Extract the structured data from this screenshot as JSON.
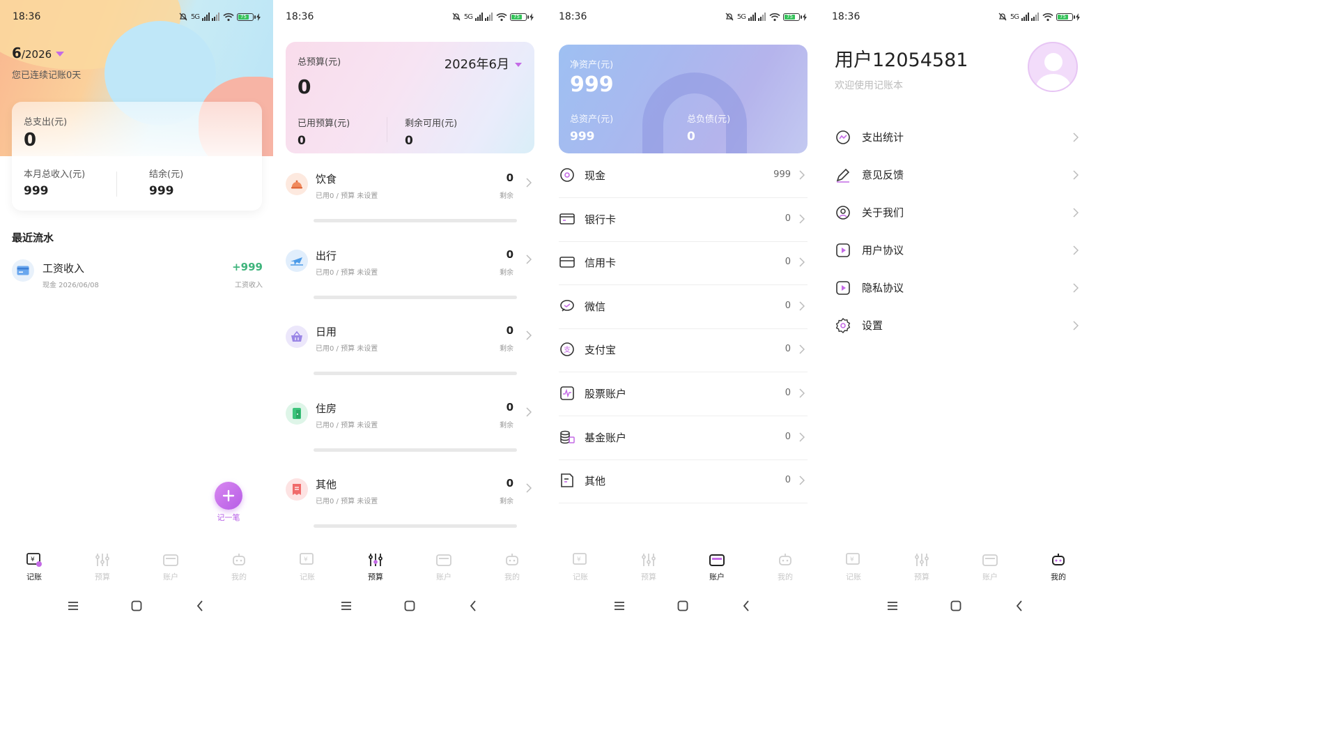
{
  "status": {
    "time": "18:36",
    "battery": "75",
    "signal": "5G"
  },
  "tabs": [
    {
      "label": "记账",
      "icon": "ledger-icon"
    },
    {
      "label": "预算",
      "icon": "sliders-icon"
    },
    {
      "label": "账户",
      "icon": "wallet-icon"
    },
    {
      "label": "我的",
      "icon": "robot-icon"
    }
  ],
  "colors": {
    "accent": "#c46ae6",
    "income": "#3fb47c"
  },
  "ledger": {
    "month_main": "6",
    "month_year": "/2026",
    "streak": "您已连续记账0天",
    "total_expense_label": "总支出(元)",
    "total_expense": "0",
    "income_label": "本月总收入(元)",
    "income": "999",
    "balance_label": "结余(元)",
    "balance": "999",
    "recent_title": "最近流水",
    "records": [
      {
        "name": "工资收入",
        "sub": "现金  2026/06/08",
        "amount": "+999",
        "category": "工资收入"
      }
    ],
    "fab_label": "记一笔"
  },
  "budget": {
    "total_label": "总预算(元)",
    "total": "0",
    "date": "2026年6月",
    "used_label": "已用预算(元)",
    "used": "0",
    "remain_label": "剩余可用(元)",
    "remain": "0",
    "categories": [
      {
        "name": "饮食",
        "sub": "已用0  / 预算 未设置",
        "value": "0",
        "remain": "剩余",
        "icon": "food-icon",
        "color": "#f08a5d",
        "progress": 0
      },
      {
        "name": "出行",
        "sub": "已用0  / 预算 未设置",
        "value": "0",
        "remain": "剩余",
        "icon": "plane-icon",
        "color": "#4c9be8",
        "progress": 0
      },
      {
        "name": "日用",
        "sub": "已用0  / 预算 未设置",
        "value": "0",
        "remain": "剩余",
        "icon": "basket-icon",
        "color": "#9b86e6",
        "progress": 0
      },
      {
        "name": "住房",
        "sub": "已用0  / 预算 未设置",
        "value": "0",
        "remain": "剩余",
        "icon": "door-icon",
        "color": "#3cc47c",
        "progress": 0
      },
      {
        "name": "其他",
        "sub": "已用0  / 预算 未设置",
        "value": "0",
        "remain": "剩余",
        "icon": "receipt-icon",
        "color": "#f06b6b",
        "progress": 0
      }
    ]
  },
  "accounts": {
    "net_label": "净资产(元)",
    "net": "999",
    "assets_label": "总资产(元)",
    "assets": "999",
    "debt_label": "总负债(元)",
    "debt": "0",
    "items": [
      {
        "name": "现金",
        "value": "999",
        "icon": "cash-icon"
      },
      {
        "name": "银行卡",
        "value": "0",
        "icon": "bank-card-icon"
      },
      {
        "name": "信用卡",
        "value": "0",
        "icon": "credit-card-icon"
      },
      {
        "name": "微信",
        "value": "0",
        "icon": "wechat-icon"
      },
      {
        "name": "支付宝",
        "value": "0",
        "icon": "alipay-icon"
      },
      {
        "name": "股票账户",
        "value": "0",
        "icon": "stock-icon"
      },
      {
        "name": "基金账户",
        "value": "0",
        "icon": "fund-icon"
      },
      {
        "name": "其他",
        "value": "0",
        "icon": "other-icon"
      }
    ]
  },
  "profile": {
    "username": "用户12054581",
    "welcome": "欢迎使用记账本",
    "menu": [
      {
        "label": "支出统计",
        "icon": "stats-icon"
      },
      {
        "label": "意见反馈",
        "icon": "pen-icon"
      },
      {
        "label": "关于我们",
        "icon": "smile-icon"
      },
      {
        "label": "用户协议",
        "icon": "play-doc-icon"
      },
      {
        "label": "隐私协议",
        "icon": "play-doc-icon"
      },
      {
        "label": "设置",
        "icon": "gear-icon"
      }
    ]
  }
}
